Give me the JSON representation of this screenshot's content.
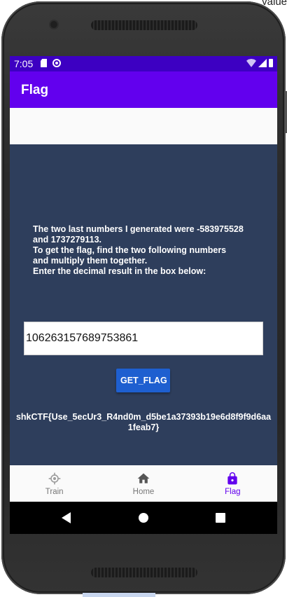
{
  "corner_text": "value",
  "status_bar": {
    "time": "7:05",
    "background": "#3d00c2"
  },
  "app_bar": {
    "title": "Flag",
    "background": "#6200ee"
  },
  "main": {
    "instructions": "The two last numbers I generated were -583975528\nand 1737279113.\nTo get the flag, find the two following numbers\nand multiply them together.\nEnter the decimal result in the box below:",
    "answer_value": "106263157689753861",
    "get_flag_label": "GET_FLAG",
    "flag_text": "shkCTF{Use_5ecUr3_R4nd0m_d5be1a37393b19e6d8f9f9d6aa1feab7}",
    "background": "#2e3e5c",
    "button_color": "#1e5fd0"
  },
  "bottom_nav": {
    "items": [
      {
        "label": "Train",
        "icon": "crosshair-icon",
        "active": false
      },
      {
        "label": "Home",
        "icon": "home-icon",
        "active": false
      },
      {
        "label": "Flag",
        "icon": "lock-icon",
        "active": true
      }
    ],
    "active_color": "#6200ee"
  },
  "system_nav": {
    "icons": [
      "back-icon",
      "home-circle-icon",
      "recents-icon"
    ]
  }
}
